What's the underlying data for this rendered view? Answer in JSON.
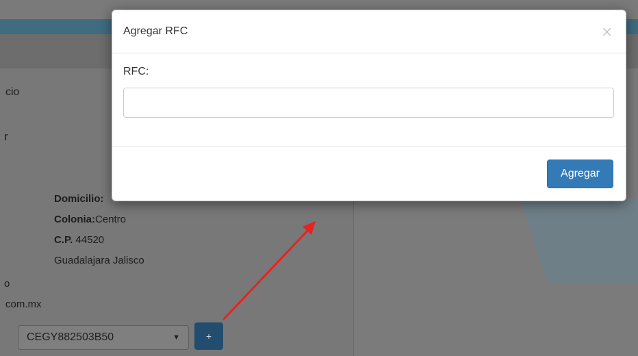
{
  "modal": {
    "title": "Agregar RFC",
    "close_label": "×",
    "rfc_label": "RFC:",
    "rfc_value": "",
    "rfc_placeholder": "",
    "submit_label": "Agregar"
  },
  "background": {
    "frag_inicio": "cio",
    "frag_r": "r",
    "domicilio_label": "Domicilio:",
    "colonia_label": "Colonia:",
    "colonia_value": "Centro",
    "cp_label": "C.P.",
    "cp_value": "44520",
    "city": "Guadalajara Jalisco",
    "frag_o": "o",
    "frag_email": "com.mx",
    "rfc_selected": "CEGY882503B50",
    "select_caret": "▼",
    "add_button_label": "+"
  },
  "colors": {
    "primary": "#337ab7",
    "annotation_arrow": "#e8231f",
    "dark_add_button": "#234d6e"
  }
}
